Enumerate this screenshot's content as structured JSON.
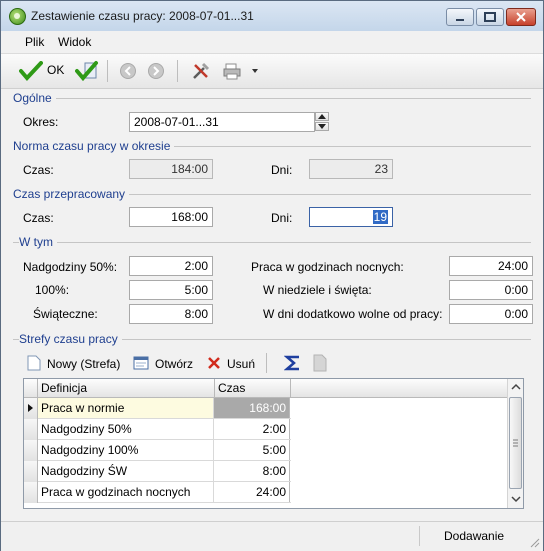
{
  "window": {
    "title": "Zestawienie czasu pracy: 2008-07-01...31"
  },
  "menu": {
    "items": [
      "Plik",
      "Widok"
    ]
  },
  "toolbar": {
    "ok_label": "OK"
  },
  "sections": {
    "general": "Ogólne",
    "norm": "Norma czasu pracy w okresie",
    "worked": "Czas przepracowany",
    "including": "W tym",
    "zones": "Strefy czasu pracy"
  },
  "general": {
    "period_label": "Okres:",
    "period_value": "2008-07-01...31"
  },
  "norm": {
    "time_label": "Czas:",
    "time_value": "184:00",
    "days_label": "Dni:",
    "days_value": "23"
  },
  "worked": {
    "time_label": "Czas:",
    "time_value": "168:00",
    "days_label": "Dni:",
    "days_value": "19"
  },
  "including": {
    "ot50_label": "Nadgodziny 50%:",
    "ot50_value": "2:00",
    "ot100_label": "100%:",
    "ot100_value": "5:00",
    "holiday_label": "Świąteczne:",
    "holiday_value": "8:00",
    "night_label": "Praca w godzinach nocnych:",
    "night_value": "24:00",
    "sundays_label": "W niedziele i święta:",
    "sundays_value": "0:00",
    "extra_days_label": "W dni dodatkowo wolne od pracy:",
    "extra_days_value": "0:00"
  },
  "zones_toolbar": {
    "new_label": "Nowy (Strefa)",
    "open_label": "Otwórz",
    "delete_label": "Usuń"
  },
  "table": {
    "columns": [
      "Definicja",
      "Czas"
    ],
    "rows": [
      {
        "definition": "Praca w normie",
        "time": "168:00"
      },
      {
        "definition": "Nadgodziny 50%",
        "time": "2:00"
      },
      {
        "definition": "Nadgodziny 100%",
        "time": "5:00"
      },
      {
        "definition": "Nadgodziny ŚW",
        "time": "8:00"
      },
      {
        "definition": "Praca w godzinach nocnych",
        "time": "24:00"
      }
    ]
  },
  "status": {
    "mode": "Dodawanie"
  }
}
